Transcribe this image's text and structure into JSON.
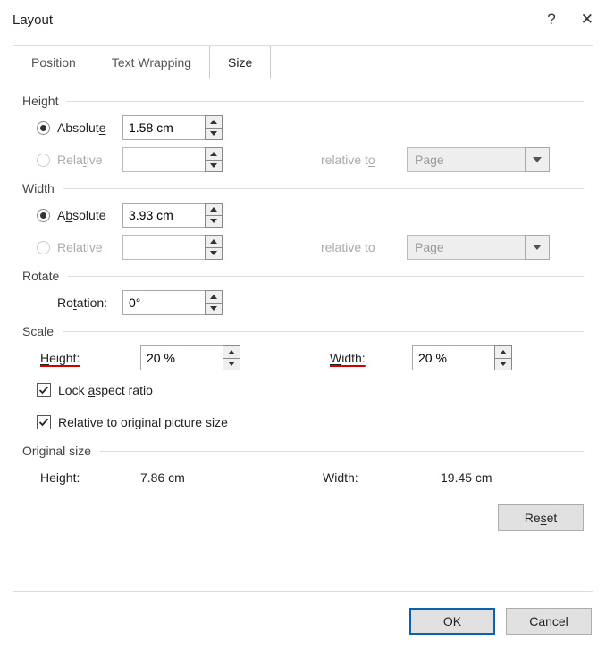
{
  "title": "Layout",
  "tabs": [
    "Position",
    "Text Wrapping",
    "Size"
  ],
  "active_tab": "Size",
  "height": {
    "heading": "Height",
    "absolute_label_pre": "Absolut",
    "absolute_label_u": "e",
    "absolute_value": "1.58 cm",
    "absolute_checked": true,
    "relative_label_pre": "Rela",
    "relative_label_u": "t",
    "relative_label_post": "ive",
    "relative_value": "",
    "relative_to_label_pre": "relative t",
    "relative_to_label_u": "o",
    "relative_to_value": "Page"
  },
  "width": {
    "heading": "Width",
    "absolute_label_pre": "A",
    "absolute_label_u": "b",
    "absolute_label_post": "solute",
    "absolute_value": "3.93 cm",
    "absolute_checked": true,
    "relative_label_pre": "Relat",
    "relative_label_u": "i",
    "relative_label_post": "ve",
    "relative_value": "",
    "relative_to_label": "relative to",
    "relative_to_value": "Page"
  },
  "rotate": {
    "heading": "Rotate",
    "label_pre": "Ro",
    "label_u": "t",
    "label_post": "ation:",
    "value": "0°"
  },
  "scale": {
    "heading": "Scale",
    "height_label_u": "H",
    "height_label_post": "eight:",
    "height_value": "20 %",
    "width_label_u": "W",
    "width_label_post": "idth:",
    "width_value": "20 %",
    "lock_pre": "Lock ",
    "lock_u": "a",
    "lock_post": "spect ratio",
    "lock_checked": true,
    "rel_orig_u": "R",
    "rel_orig_post": "elative to original picture size",
    "rel_orig_checked": true
  },
  "original": {
    "heading": "Original size",
    "height_label": "Height:",
    "height_value": "7.86 cm",
    "width_label": "Width:",
    "width_value": "19.45 cm",
    "reset_pre": "Re",
    "reset_u": "s",
    "reset_post": "et"
  },
  "buttons": {
    "ok": "OK",
    "cancel": "Cancel"
  }
}
